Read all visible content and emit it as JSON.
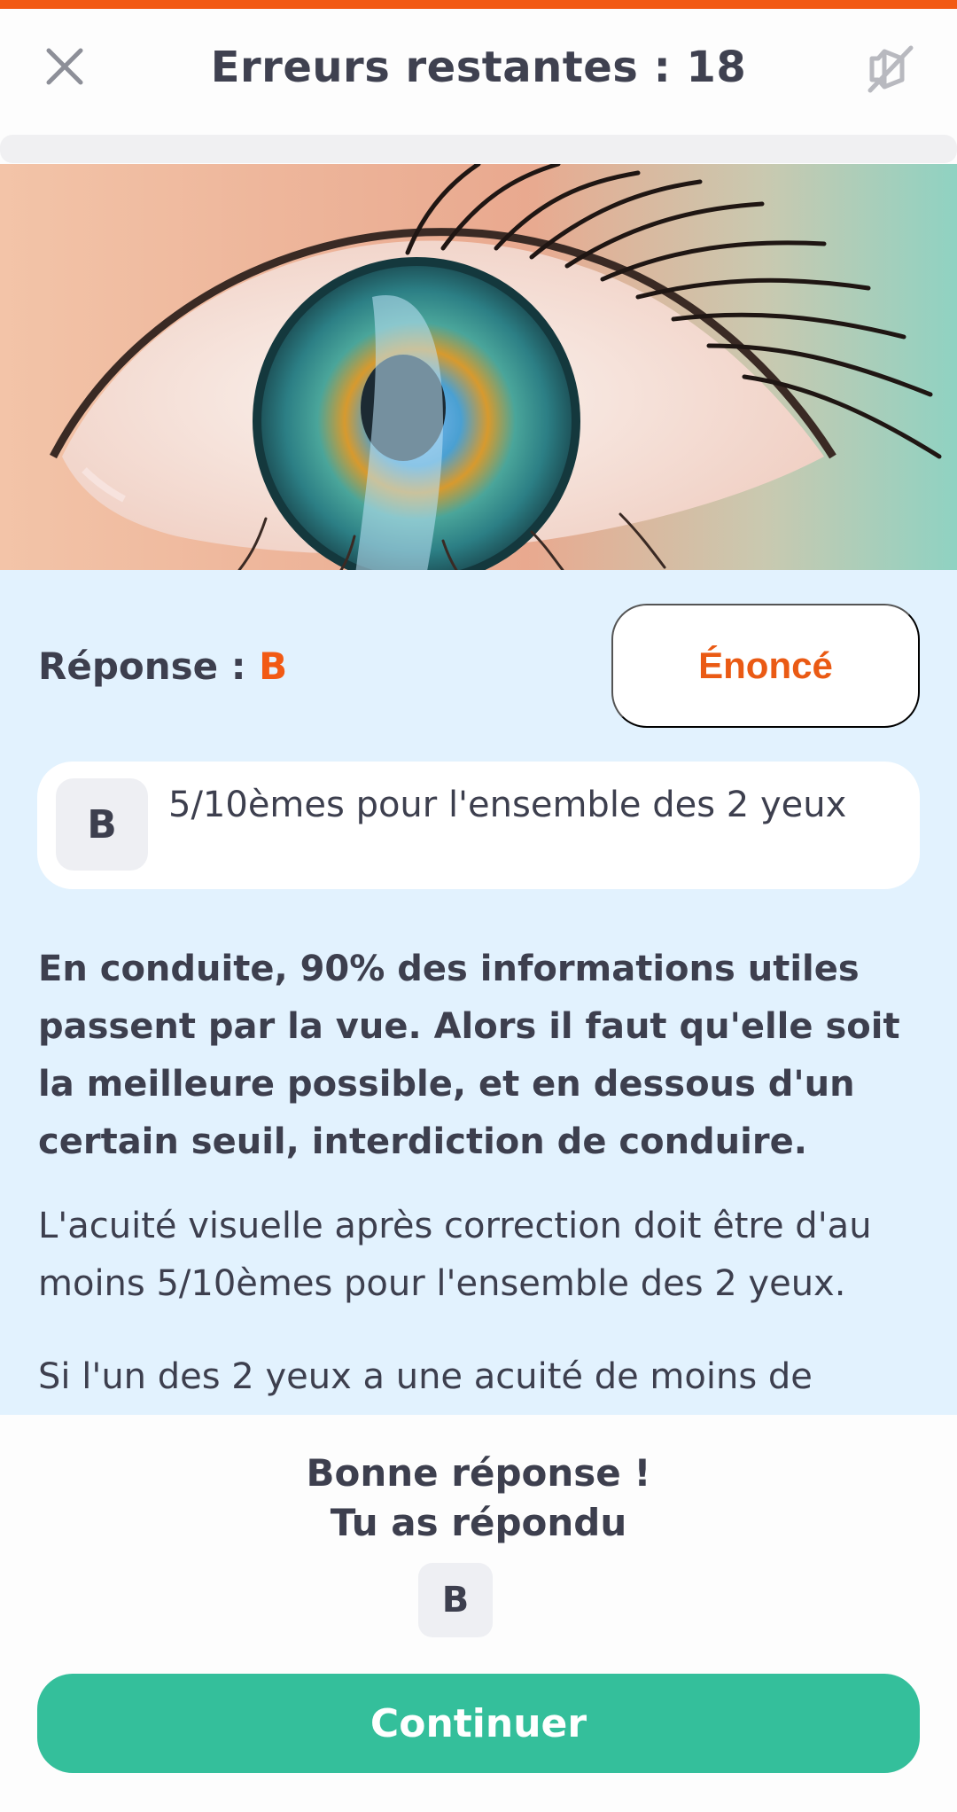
{
  "header": {
    "title": "Erreurs restantes : 18",
    "close_icon": "close-icon",
    "sound_icon": "sound-off-icon"
  },
  "answer": {
    "label": "Réponse : ",
    "letter": "B",
    "statement_button": "Énoncé"
  },
  "option": {
    "letter": "B",
    "text": "5/10èmes pour l'ensemble des 2 yeux"
  },
  "explanation": {
    "lead": "En conduite, 90% des informations utiles passent par la vue. Alors il faut qu'elle soit la meilleure possible, et en dessous d'un certain seuil, interdiction de conduire.",
    "paragraphs": [
      "L'acuité visuelle après correction doit être d'au moins 5/10èmes pour l'ensemble des 2 yeux.",
      "Si l'un des 2 yeux a une acuité de moins de"
    ]
  },
  "result": {
    "line1": "Bonne réponse !",
    "line2": "Tu as répondu",
    "user_letter": "B",
    "continue_label": "Continuer"
  },
  "colors": {
    "accent": "#f25a14",
    "content_bg": "#e2f2fe",
    "continue": "#34bf9b",
    "text": "#3d3f4e"
  }
}
